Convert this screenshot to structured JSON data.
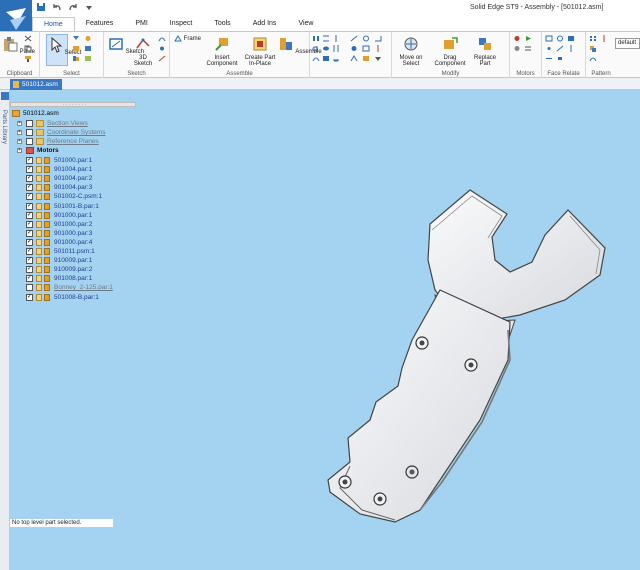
{
  "window": {
    "title": "Solid Edge ST9 - Assembly - [501012.asm]"
  },
  "ribbon_tabs": [
    "Home",
    "Features",
    "PMI",
    "Inspect",
    "Tools",
    "Add Ins",
    "View"
  ],
  "groups": {
    "clipboard": {
      "label": "Clipboard",
      "paste": "Paste"
    },
    "select": {
      "label": "Select",
      "select": "Select"
    },
    "sketch": {
      "label": "Sketch",
      "sketch": "Sketch",
      "sketch3d_line1": "3D",
      "sketch3d_line2": "Sketch",
      "frame": "Frame"
    },
    "assemble": {
      "label": "Assemble",
      "insert_line1": "Insert",
      "insert_line2": "Component",
      "create_line1": "Create Part",
      "create_line2": "In-Place",
      "assemble": "Assemble"
    },
    "modify": {
      "label": "Modify",
      "move_line1": "Move on",
      "move_line2": "Select",
      "drag_line1": "Drag",
      "drag_line2": "Component",
      "replace_line1": "Replace",
      "replace_line2": "Part"
    },
    "motors": {
      "label": "Motors"
    },
    "face_relate": {
      "label": "Face Relate"
    },
    "pattern": {
      "label": "Pattern"
    }
  },
  "style_combo": "default",
  "document_tab": "501012.asm",
  "left_strip_label": "Parts Library",
  "tree": {
    "root": "501012.asm",
    "section_views": "Section Views",
    "coordinate_systems": "Coordinate Systems",
    "reference_planes": "Reference Planes",
    "motors": "Motors",
    "parts": [
      {
        "name": "501000.par:1",
        "checked": true,
        "style": "link"
      },
      {
        "name": "901004.par:1",
        "checked": true,
        "style": "link"
      },
      {
        "name": "901004.par:2",
        "checked": true,
        "style": "link"
      },
      {
        "name": "901004.par:3",
        "checked": true,
        "style": "link"
      },
      {
        "name": "501002-C.psm:1",
        "checked": true,
        "style": "link"
      },
      {
        "name": "501001-B.par:1",
        "checked": true,
        "style": "link"
      },
      {
        "name": "901000.par:1",
        "checked": true,
        "style": "link"
      },
      {
        "name": "901000.par:2",
        "checked": true,
        "style": "link"
      },
      {
        "name": "901000.par:3",
        "checked": true,
        "style": "link"
      },
      {
        "name": "901000.par:4",
        "checked": true,
        "style": "link"
      },
      {
        "name": "501011.psm:1",
        "checked": true,
        "style": "link"
      },
      {
        "name": "910009.par:1",
        "checked": true,
        "style": "link"
      },
      {
        "name": "910009.par:2",
        "checked": true,
        "style": "link"
      },
      {
        "name": "901008.par:1",
        "checked": true,
        "style": "link"
      },
      {
        "name": "Bonney_2-125.par:1",
        "checked": false,
        "style": "grey"
      },
      {
        "name": "501008-B.par:1",
        "checked": true,
        "style": "link"
      }
    ]
  },
  "status": "No top level part selected.",
  "colors": {
    "viewport": "#a3d3f0",
    "ribbon_accent": "#1a57a8",
    "doc_tab": "#3a78c2",
    "tree_link": "#1f3d8f"
  }
}
